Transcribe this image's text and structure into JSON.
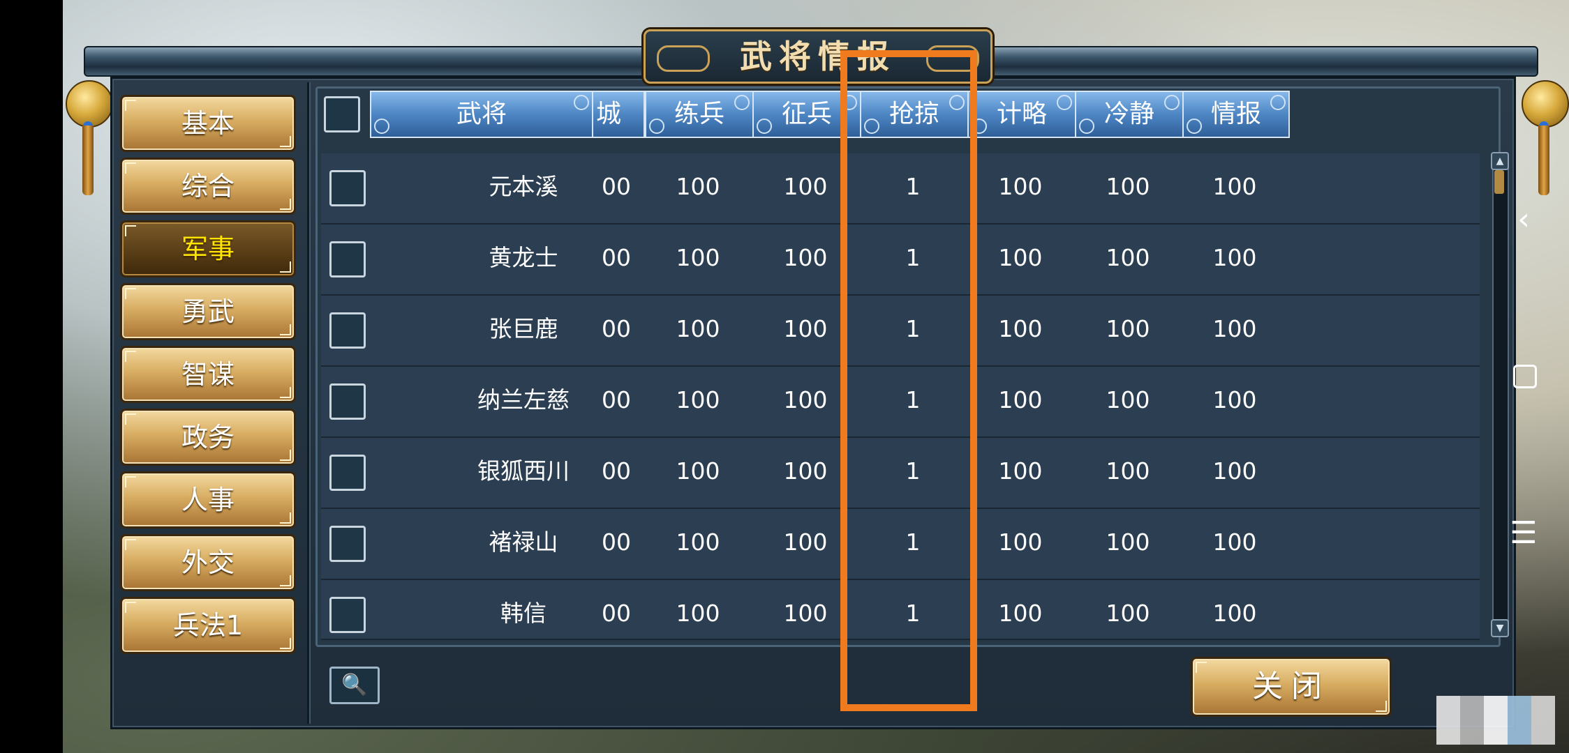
{
  "window": {
    "title": "武将情报"
  },
  "sidebar": {
    "items": [
      {
        "label": "基本",
        "active": false
      },
      {
        "label": "综合",
        "active": false
      },
      {
        "label": "军事",
        "active": true
      },
      {
        "label": "勇武",
        "active": false
      },
      {
        "label": "智谋",
        "active": false
      },
      {
        "label": "政务",
        "active": false
      },
      {
        "label": "人事",
        "active": false
      },
      {
        "label": "外交",
        "active": false
      },
      {
        "label": "兵法1",
        "active": false
      }
    ]
  },
  "table": {
    "columns": [
      "武将",
      "城",
      "练兵",
      "征兵",
      "抢掠",
      "计略",
      "冷静",
      "情报"
    ],
    "rows": [
      {
        "name": "元本溪",
        "cells": [
          "00",
          "100",
          "100",
          "1",
          "100",
          "100",
          "100"
        ]
      },
      {
        "name": "黄龙士",
        "cells": [
          "00",
          "100",
          "100",
          "1",
          "100",
          "100",
          "100"
        ]
      },
      {
        "name": "张巨鹿",
        "cells": [
          "00",
          "100",
          "100",
          "1",
          "100",
          "100",
          "100"
        ]
      },
      {
        "name": "纳兰左慈",
        "cells": [
          "00",
          "100",
          "100",
          "1",
          "100",
          "100",
          "100"
        ]
      },
      {
        "name": "银狐西川",
        "cells": [
          "00",
          "100",
          "100",
          "1",
          "100",
          "100",
          "100"
        ]
      },
      {
        "name": "褚禄山",
        "cells": [
          "00",
          "100",
          "100",
          "1",
          "100",
          "100",
          "100"
        ]
      },
      {
        "name": "韩信",
        "cells": [
          "00",
          "100",
          "100",
          "1",
          "100",
          "100",
          "100"
        ]
      }
    ]
  },
  "footer": {
    "filter_icon": "🔍",
    "close_label": "关闭"
  },
  "system_nav": {
    "back_icon": "‹",
    "menu_icon": "☰"
  },
  "colors": {
    "highlight": "#f07a1e",
    "active_tab_text": "#ffe400"
  }
}
